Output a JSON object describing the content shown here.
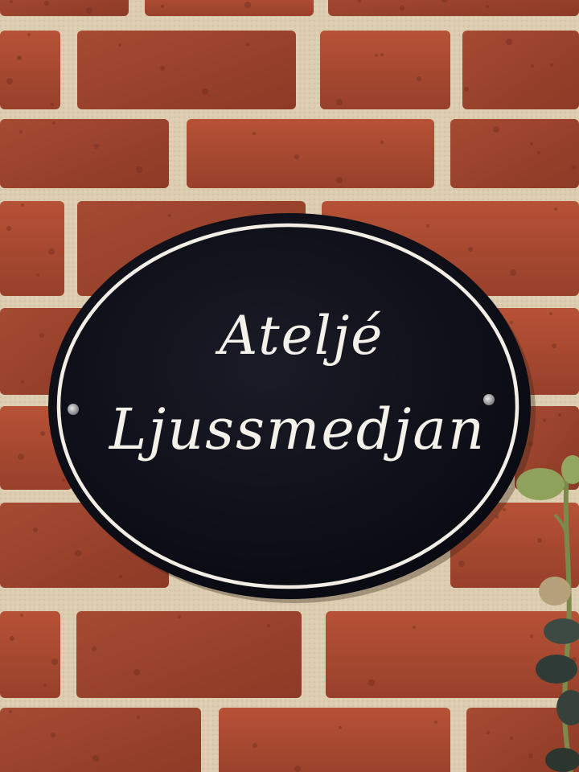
{
  "photo": {
    "subject": "oval-house-sign-on-brick-wall"
  },
  "sign": {
    "line1": "Atelјé",
    "line2": "Ljussmedjan",
    "plate_color": "#0e0f18",
    "border_color": "#f2eee6",
    "text_color": "#f4f1ea"
  },
  "wall": {
    "brick_color": "#a8452e",
    "mortar_color": "#dccdb0"
  },
  "plant": {
    "leaf_color": "#8fa25c"
  }
}
